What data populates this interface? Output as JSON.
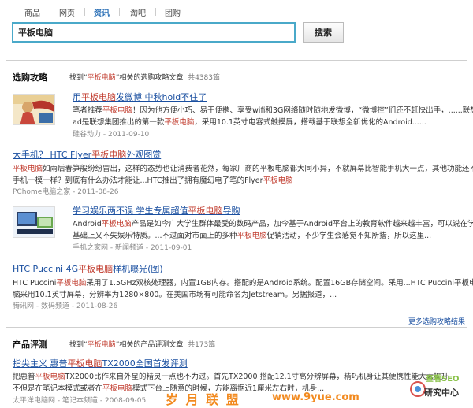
{
  "tabs": [
    "商品",
    "网页",
    "资讯",
    "淘吧",
    "团购"
  ],
  "search": {
    "value": "平板电脑",
    "button": "搜索"
  },
  "section_guides": {
    "title": "选购攻略",
    "desc_pre": "找到“",
    "keyword": "平板电脑",
    "desc_post": "”相关的选购攻略文章",
    "count": "共4383篇",
    "items": [
      {
        "title_pre": "用",
        "title_kw": "平板电脑",
        "title_post": "发微博 中秋hold不住了",
        "l1_pre": "笔者推荐",
        "l1_kw": "平板电脑",
        "l1_post": "！因为他方便小巧、易于便携、享受wifi和3G网络随时随地发微博，“微博控”们还不赶快出手，......联想乐P",
        "l2_pre": "ad是联想集团推出的第一款",
        "l2_kw": "平板电脑",
        "l2_post": "，采用10.1英寸电容式触摸屏，搭载基于联想全新优化的Android......",
        "meta": "硅谷动力 - 2011-09-10"
      },
      {
        "title_pre": "大手机？ HTC Flyer",
        "title_kw": "平板电脑",
        "title_post": "外观图赏",
        "l1_pre": "",
        "l1_kw": "平板电脑",
        "l1_post": "如雨后春笋般纷纷冒出，这样的态势也让消费者花然，每家厂商的平板电脑都大同小异，不就屏幕比智能手机大一点，其他功能还不和",
        "l2_pre": "手机一模一样？到底有什么办法才能让...HTC推出了拥有魔幻电子笔的Flyer",
        "l2_kw": "平板电脑",
        "l2_post": "",
        "meta": "PChome电脑之家 - 2011-08-26"
      },
      {
        "title_pre": "学习娱乐两不误 学生专属超值",
        "title_kw": "平板电脑",
        "title_post": "导购",
        "l1_pre": "Android",
        "l1_kw": "平板电脑",
        "l1_post": "产品是如今广大学生群体最受的数码产品，加今基于Android平台上的教育软件越来越丰富，可以说在学习",
        "l2_pre": "基础上又不失娱乐特质。...不过面对市面上的多种",
        "l2_kw": "平板电脑",
        "l2_post": "促销活动，不少学生会感觉不知所措，所以这里...",
        "meta": "手机之家网 - 新闻频道 - 2011-09-01"
      },
      {
        "title_pre": "HTC Puccini 4G",
        "title_kw": "平板电脑",
        "title_post": "样机曝光(图)",
        "l1_pre": "HTC Puccini",
        "l1_kw": "平板电脑",
        "l1_post": "采用了1.5GHz双核处理器，内置1GB内存。搭配的是Android系统。配置16GB存储空间。采用...HTC Puccini平板电",
        "l2_pre": "脑采用10.1英寸屏幕，分辨率为1280×800。在美国市场有可能命名为Jetstream。另据报道，...",
        "l2_kw": "",
        "l2_post": "",
        "meta": "腾讯网 - 数码频道 - 2011-08-26"
      }
    ],
    "more": "更多选购攻略结果"
  },
  "section_reviews": {
    "title": "产品评测",
    "desc_pre": "找到“",
    "keyword": "平板电脑",
    "desc_post": "”相关的产品评测文章",
    "count": "共173篇",
    "items": [
      {
        "title_pre": "指尖主义 惠普",
        "title_kw": "平板电脑",
        "title_post": "TX2000全国首发评测",
        "l1_pre": "把惠普",
        "l1_kw": "平板电脑",
        "l1_post": "TX2000比作来自外星的精灵一点也不为过。首先TX2000 搭配12.1寸高分辨屏幕，精巧机身让其便携性能大大提升",
        "l2_pre": "不但是在笔记本模式或者在",
        "l2_kw": "平板电脑",
        "l2_post": "模式下台上随意的时候，方能离据近1厘米左右时，机身...",
        "meta": "太平洋电脑网 - 笔记本频道 - 2008-09-05"
      }
    ]
  },
  "watermark": {
    "left": "岁 月 联 盟",
    "mid": "www.9yue.com",
    "brand_top": "查看SEO",
    "brand_bottom": "研究中心"
  },
  "colors": {
    "link": "#1a4fa0",
    "highlight": "#c0392b",
    "input_border": "#4aa9c9",
    "watermark": "#f28a1f"
  }
}
